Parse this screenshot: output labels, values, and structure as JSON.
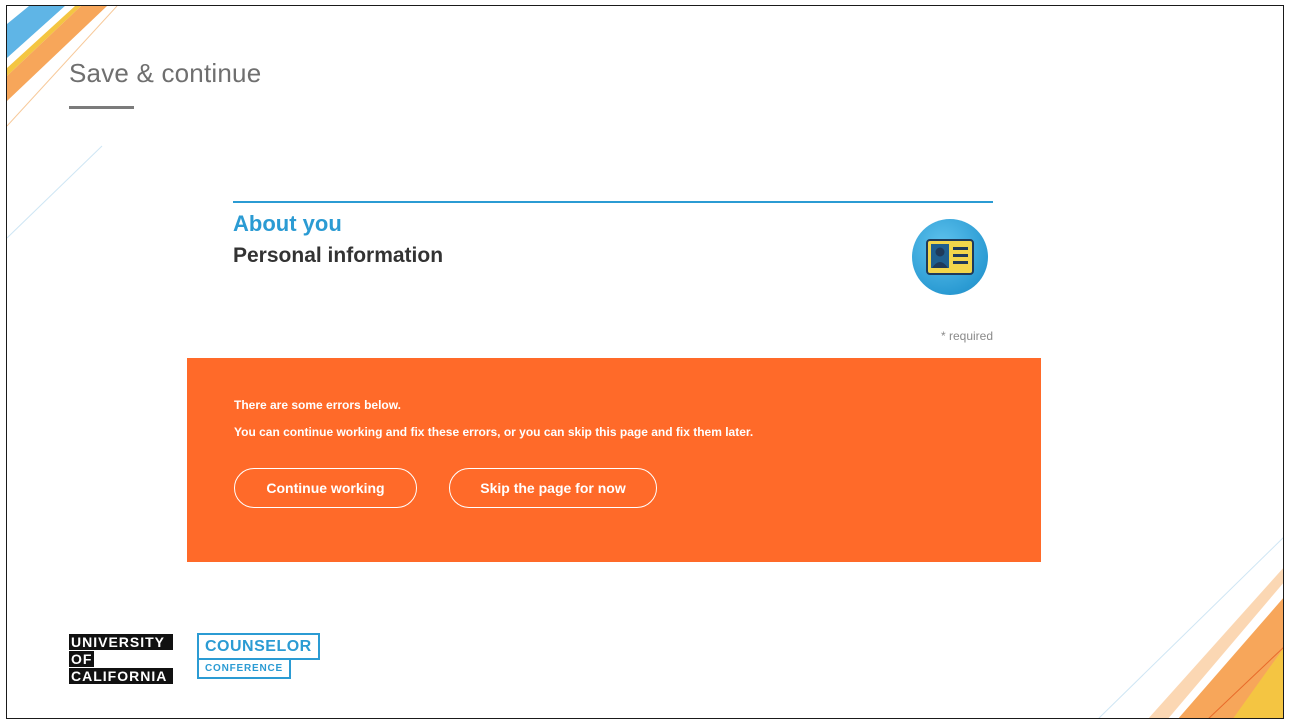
{
  "slide": {
    "title": "Save & continue"
  },
  "form": {
    "section_title": "About you",
    "subsection_title": "Personal information",
    "badge_icon": "id-card-icon",
    "required_note": "* required"
  },
  "error_panel": {
    "headline": "There are some errors below.",
    "message": "You can continue working and fix these errors, or you can skip this page and fix them later.",
    "continue_label": "Continue working",
    "skip_label": "Skip the page for now"
  },
  "footer": {
    "uc_logo": {
      "line1": "UNIVERSITY",
      "line2": "OF",
      "line3": "CALIFORNIA"
    },
    "counselor_logo": {
      "main": "COUNSELOR",
      "sub": "CONFERENCE"
    }
  },
  "colors": {
    "accent_blue": "#2b9bd3",
    "error_orange": "#ff6a29",
    "title_gray": "#6f6f6f"
  }
}
